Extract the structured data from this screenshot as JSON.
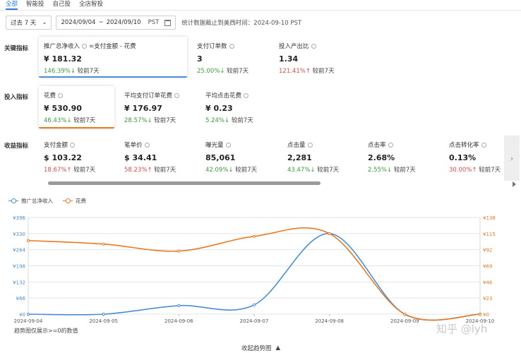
{
  "tabs": [
    "全部",
    "智能投",
    "自己投",
    "全店智投"
  ],
  "filters": {
    "period": "过去 7 天",
    "date_start": "2024/09/04",
    "date_sep": "~",
    "date_end": "2024/09/10",
    "timezone": "PST",
    "stat_note": "统计数据截止到美西时间：2024-09-10 PST"
  },
  "sections": {
    "key": "关键指标",
    "input": "投入指标",
    "output": "收益指标"
  },
  "key_metrics": [
    {
      "name": "推广总净收入",
      "formula": "=支付金额 - 花费",
      "value": "¥ 181.32",
      "change": "146.39%↓",
      "dir": "down",
      "compare": "较前7天"
    },
    {
      "name": "支付订单数",
      "value": "3",
      "change": "25.00%↓",
      "dir": "down",
      "compare": "较前7天"
    },
    {
      "name": "投入产出比",
      "value": "1.34",
      "change": "121.41%↑",
      "dir": "up",
      "compare": "较前7天"
    }
  ],
  "input_metrics": [
    {
      "name": "花费",
      "value": "¥ 530.90",
      "change": "46.43%↓",
      "dir": "down",
      "compare": "较前7天"
    },
    {
      "name": "平均支付订单花费",
      "value": "¥ 176.97",
      "change": "28.57%↓",
      "dir": "down",
      "compare": "较前7天"
    },
    {
      "name": "平均点击花费",
      "value": "¥ 0.23",
      "change": "5.24%↓",
      "dir": "down",
      "compare": "较前7天"
    }
  ],
  "output_metrics": [
    {
      "name": "支付金额",
      "value": "$ 103.22",
      "change": "18.67%↑",
      "dir": "up",
      "compare": "较前7天"
    },
    {
      "name": "笔单价",
      "value": "$ 34.41",
      "change": "58.23%↑",
      "dir": "up",
      "compare": "较前7天"
    },
    {
      "name": "曝光量",
      "value": "85,061",
      "change": "42.09%↓",
      "dir": "down",
      "compare": "较前7天"
    },
    {
      "name": "点击量",
      "value": "2,281",
      "change": "43.47%↓",
      "dir": "down",
      "compare": "较前7天"
    },
    {
      "name": "点击率",
      "value": "2.68%",
      "change": "2.55%↓",
      "dir": "down",
      "compare": "较前7天"
    },
    {
      "name": "点击转化率",
      "value": "0.13%",
      "change": "30.00%↑",
      "dir": "up",
      "compare": "较前7天"
    }
  ],
  "side_arrow": "›",
  "colors": {
    "blue": "#4a8fd8",
    "orange": "#e87a22",
    "up": "#e04848",
    "down": "#3d9b3d"
  },
  "chart_data": {
    "type": "line",
    "x": [
      "2024-09-04",
      "2024-09-05",
      "2024-09-06",
      "2024-09-07",
      "2024-09-08",
      "2024-09-09",
      "2024-09-10"
    ],
    "series": [
      {
        "name": "推广总净收入",
        "axis": "left",
        "color": "#4a8fd8",
        "values": [
          0,
          0,
          35,
          38,
          330,
          0,
          0
        ]
      },
      {
        "name": "花费",
        "axis": "right",
        "color": "#e87a22",
        "values": [
          105,
          100,
          90,
          111,
          115,
          0,
          0
        ]
      }
    ],
    "y_left": {
      "ticks": [
        0,
        66,
        132,
        198,
        264,
        330,
        396
      ],
      "labels": [
        "¥0",
        "¥66",
        "¥132",
        "¥198",
        "¥264",
        "¥330",
        "¥396"
      ],
      "ylim": [
        0,
        396
      ]
    },
    "y_right": {
      "ticks": [
        0,
        23,
        46,
        69,
        92,
        115,
        138
      ],
      "labels": [
        "¥0",
        "¥23",
        "¥46",
        "¥69",
        "¥92",
        "¥115",
        "¥138"
      ],
      "ylim": [
        0,
        138
      ]
    },
    "grid": true,
    "legend": "top-left"
  },
  "chart_note": "趋势图仅展示>=0的数值",
  "collapse_label": "收起趋势图",
  "watermark": "知乎 @lyh"
}
